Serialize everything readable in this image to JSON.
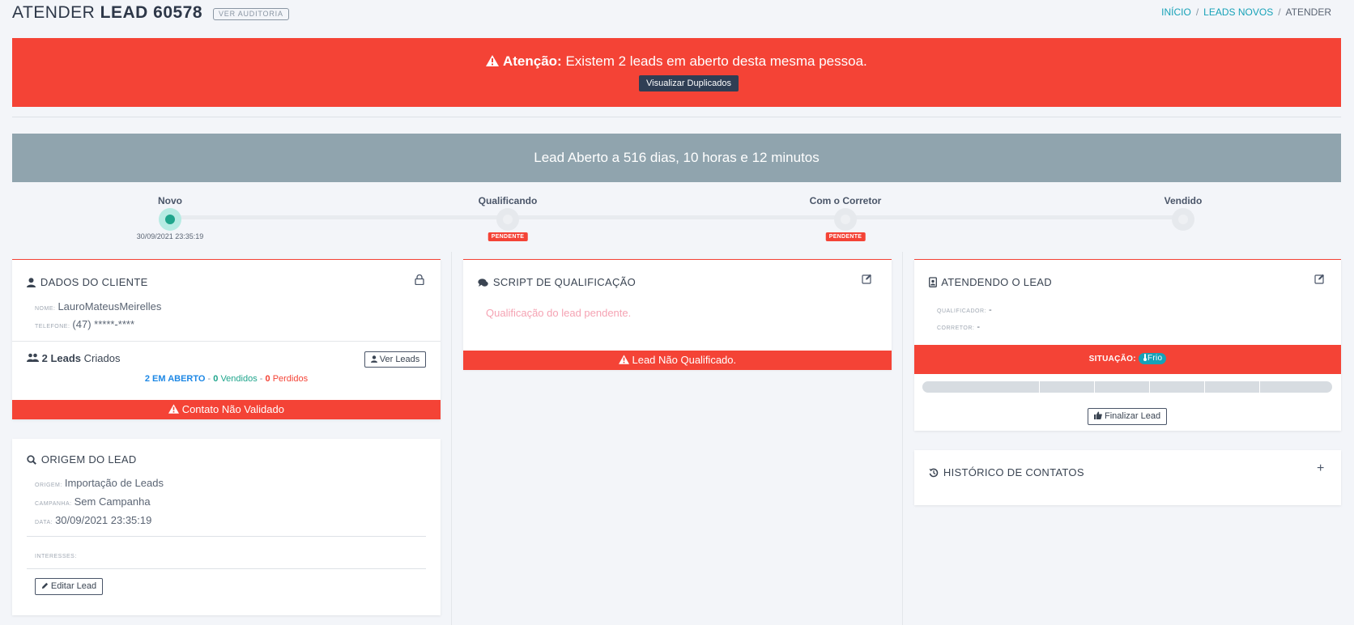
{
  "header": {
    "title_prefix": "ATENDER",
    "title_lead": "LEAD 60578",
    "audit_button": "VER AUDITORIA",
    "breadcrumb": {
      "home": "INÍCIO",
      "section": "LEADS NOVOS",
      "current": "ATENDER"
    }
  },
  "alert": {
    "strong": "Atenção:",
    "message": "Existem 2 leads em aberto desta mesma pessoa.",
    "button": "Visualizar Duplicados"
  },
  "time_banner": "Lead Aberto a 516 dias, 10 horas e 12 minutos",
  "stepper": {
    "steps": [
      {
        "label": "Novo",
        "date": "30/09/2021 23:35:19",
        "status": ""
      },
      {
        "label": "Qualificando",
        "date": "",
        "status": "PENDENTE"
      },
      {
        "label": "Com o Corretor",
        "date": "",
        "status": "PENDENTE"
      },
      {
        "label": "Vendido",
        "date": "",
        "status": ""
      }
    ]
  },
  "client_card": {
    "title": "DADOS DO CLIENTE",
    "name_label": "NOME:",
    "name_value": "LauroMateusMeirelles",
    "phone_label": "TELEFONE:",
    "phone_value": "(47) *****-****",
    "leads_count": "2 Leads",
    "leads_suffix": "Criados",
    "ver_leads": "Ver Leads",
    "open_text": "2 EM ABERTO",
    "sold_count": "0",
    "sold_text": "Vendidos",
    "lost_count": "0",
    "lost_text": "Perdidos",
    "dash": "-",
    "warning": "Contato Não Validado"
  },
  "origin_card": {
    "title": "ORIGEM DO LEAD",
    "origem_label": "ORIGEM:",
    "origem_value": "Importação de Leads",
    "campanha_label": "CAMPANHA:",
    "campanha_value": "Sem Campanha",
    "data_label": "DATA:",
    "data_value": "30/09/2021 23:35:19",
    "interesses_label": "INTERESSES:",
    "edit_button": "Editar Lead"
  },
  "script_card": {
    "title": "SCRIPT DE QUALIFICAÇÃO",
    "pending": "Qualificação do lead pendente.",
    "warning": "Lead Não Qualificado."
  },
  "attending_card": {
    "title": "ATENDENDO O LEAD",
    "qualificador_label": "QUALIFICADOR:",
    "qualificador_value": "-",
    "corretor_label": "CORRETOR:",
    "corretor_value": "-",
    "situacao_label": "SITUAÇÃO:",
    "situacao_value": "Frio",
    "progress_fraction": 0,
    "finalize_button": "Finalizar Lead"
  },
  "history_card": {
    "title": "HISTÓRICO DE CONTATOS",
    "add": "+"
  },
  "colors": {
    "danger": "#f44336",
    "banner": "#90a4ae",
    "teal": "#17a2b8",
    "green": "#1fa58c",
    "navy": "#2f3e54"
  }
}
